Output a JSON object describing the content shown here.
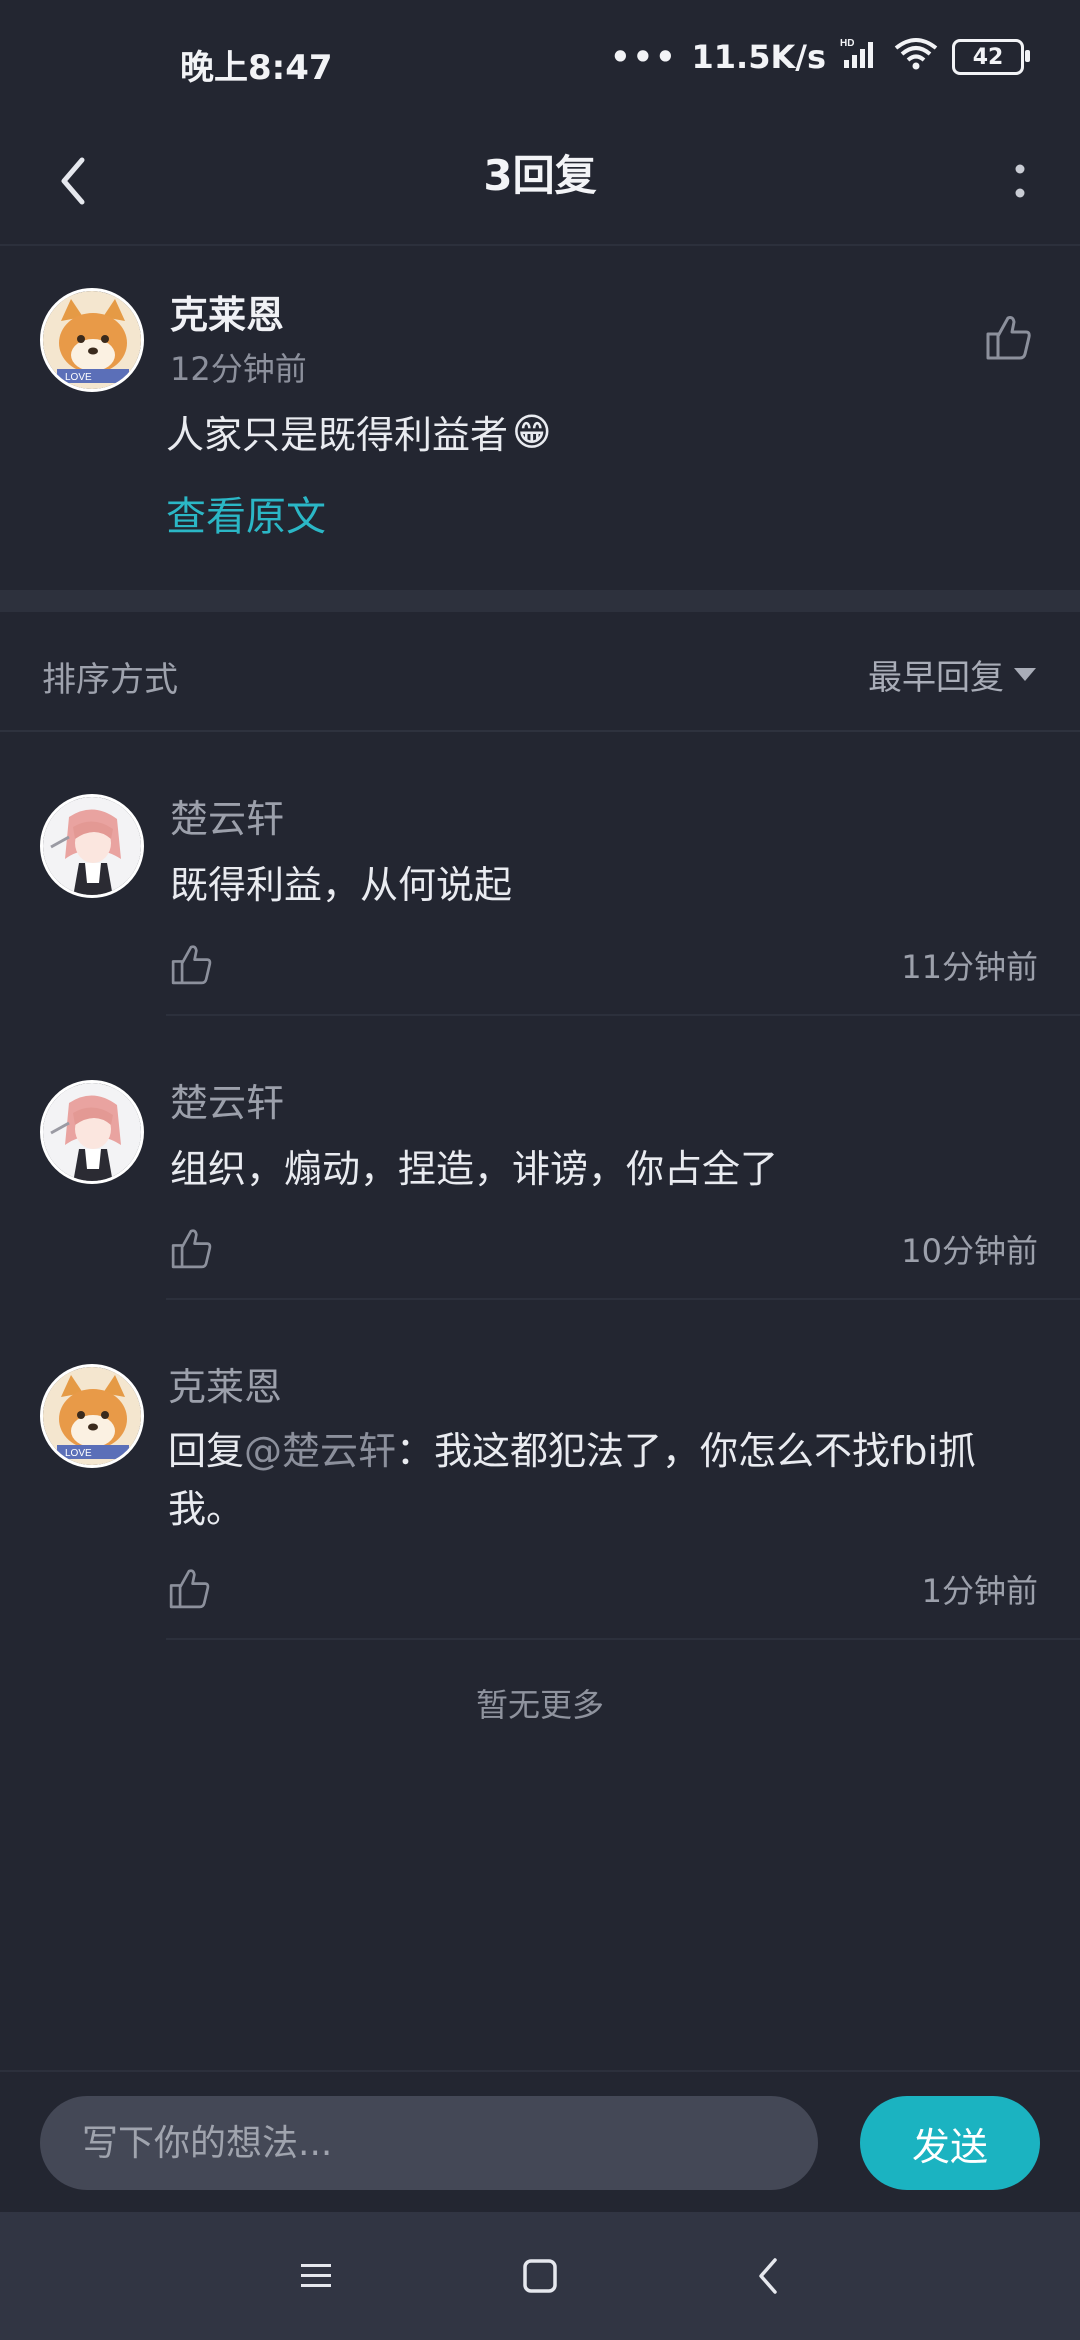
{
  "status_bar": {
    "time": "晚上8:47",
    "dots": "•••",
    "network_speed": "11.5K/s",
    "battery": "42"
  },
  "header": {
    "title": "3回复",
    "back_icon": "chevron-left-icon",
    "more_icon": "more-vertical-icon"
  },
  "original_comment": {
    "user_name": "克莱恩",
    "time": "12分钟前",
    "text": "人家只是既得利益者",
    "emoji": "😁",
    "view_original_label": "查看原文"
  },
  "sort": {
    "label": "排序方式",
    "selected": "最早回复"
  },
  "replies": [
    {
      "user_name": "楚云轩",
      "text": "既得利益，从何说起",
      "time": "11分钟前"
    },
    {
      "user_name": "楚云轩",
      "text": "组织，煽动，捏造，诽谤，你占全了",
      "time": "10分钟前"
    },
    {
      "user_name": "克莱恩",
      "prefix": "回复",
      "mention": "@楚云轩",
      "text": "：我这都犯法了，你怎么不找fbi抓我。",
      "time": "1分钟前"
    }
  ],
  "footer": {
    "no_more": "暂无更多"
  },
  "input": {
    "placeholder": "写下你的想法...",
    "send_label": "发送"
  },
  "colors": {
    "background": "#232631",
    "accent": "#1bb3c1",
    "link": "#2bb7c6"
  }
}
